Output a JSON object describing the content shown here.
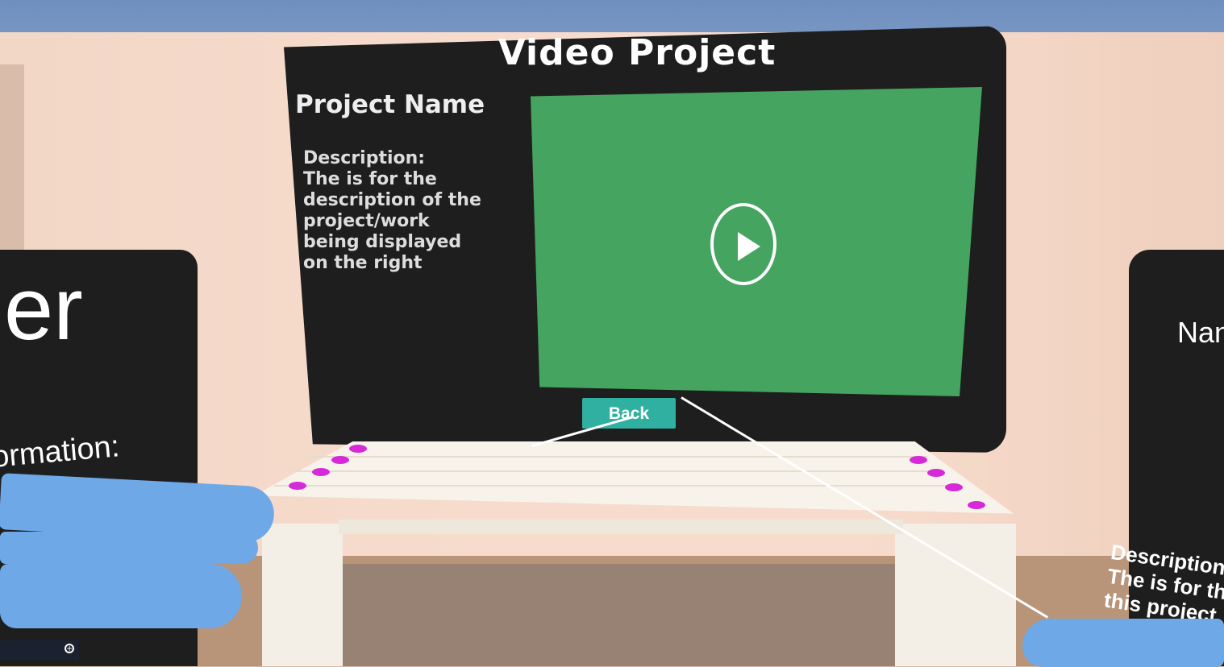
{
  "scene": {
    "main_panel": {
      "title": "Video Project",
      "project_name": "Project Name",
      "description_lines": [
        "Description:",
        "The is for the",
        "description of the",
        "project/work",
        "being displayed",
        "on the right"
      ],
      "play_icon": "play-circle-icon",
      "back_label": "Back"
    },
    "left_panel": {
      "big_text": "er",
      "info_text": "ormation:"
    },
    "right_panel": {
      "name_text": "Nan",
      "desc_lines": [
        "Description:",
        "The is for th",
        "this project"
      ]
    },
    "colors": {
      "panel": "#1e1e1e",
      "video_bg": "#44a460",
      "back_button": "#2fb0a1",
      "hand": "#6ea8e6",
      "peg": "#d62ad8"
    }
  }
}
